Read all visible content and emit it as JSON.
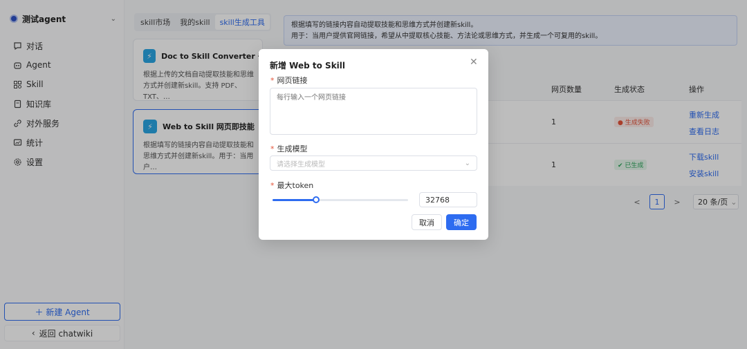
{
  "sidebar": {
    "agent_name": "测试agent",
    "items": [
      {
        "label": "对话",
        "icon": "chat-icon"
      },
      {
        "label": "Agent",
        "icon": "robot-icon"
      },
      {
        "label": "Skill",
        "icon": "skill-icon"
      },
      {
        "label": "知识库",
        "icon": "library-icon"
      },
      {
        "label": "对外服务",
        "icon": "link-icon"
      },
      {
        "label": "统计",
        "icon": "chart-icon"
      },
      {
        "label": "设置",
        "icon": "gear-icon"
      }
    ],
    "new_agent": "新建 Agent",
    "back": "返回 chatwiki"
  },
  "tabs": [
    "skill市场",
    "我的skill",
    "skill生成工具"
  ],
  "active_tab": 2,
  "cards": [
    {
      "title": "Doc to Skill Converter 书…",
      "desc": "根据上传的文档自动提取技能和思维方式并创建新skill。支持 PDF、TXT、…"
    },
    {
      "title": "Web to Skill 网页即技能",
      "desc": "根据填写的链接内容自动提取技能和思维方式并创建新skill。用于：当用户…"
    }
  ],
  "info": {
    "line1": "根据填写的链接内容自动提取技能和思维方式并创建新skill。",
    "line2": "用于：当用户提供官网链接，希望从中提取核心技能、方法论或思维方式，并生成一个可复用的skill。"
  },
  "table": {
    "headers": {
      "pages": "网页数量",
      "status": "生成状态",
      "actions": "操作"
    },
    "rows": [
      {
        "pages": "1",
        "status": "生成失败",
        "actions": [
          "重新生成",
          "查看日志"
        ]
      },
      {
        "pages": "1",
        "status": "已生成",
        "actions": [
          "下载skill",
          "安装skill"
        ]
      }
    ]
  },
  "pagination": {
    "prev": "<",
    "current": "1",
    "next": ">",
    "page_size": "20 条/页"
  },
  "modal": {
    "title": "新增 Web to Skill",
    "url_label": "网页链接",
    "url_placeholder": "每行输入一个网页链接",
    "model_label": "生成模型",
    "model_placeholder": "请选择生成模型",
    "token_label": "最大token",
    "token_value": "32768",
    "slider_fraction": 0.32,
    "cancel": "取消",
    "confirm": "确定"
  },
  "colors": {
    "accent": "#2e6cf0",
    "fail": "#e4543a",
    "success": "#2aa55a"
  }
}
